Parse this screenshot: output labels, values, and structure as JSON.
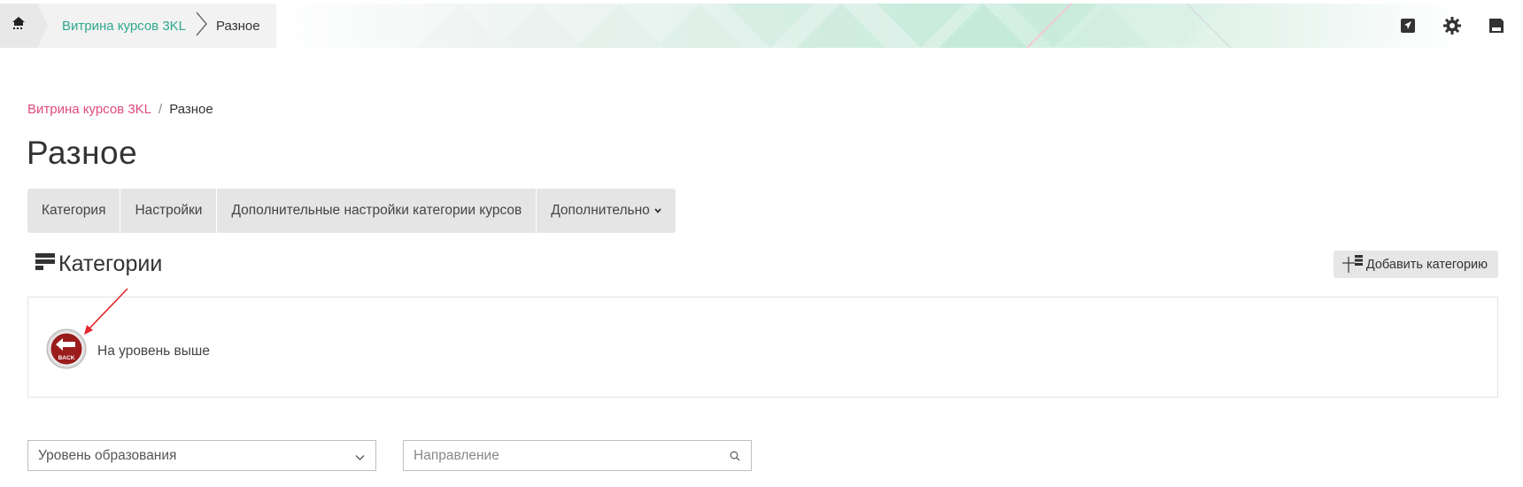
{
  "topbar": {
    "home_icon": "home-icon",
    "crumb_link": "Витрина курсов 3KL",
    "crumb_current": "Разное",
    "icons": [
      "send-icon",
      "gear-icon",
      "save-icon"
    ]
  },
  "breadcrumb": {
    "link": "Витрина курсов 3KL",
    "separator": "/",
    "current": "Разное"
  },
  "page_title": "Разное",
  "tabs": [
    {
      "label": "Категория"
    },
    {
      "label": "Настройки"
    },
    {
      "label": "Дополнительные настройки категории курсов"
    },
    {
      "label": "Дополнительно"
    }
  ],
  "categories": {
    "title": "Категории",
    "add_button": "Добавить категорию",
    "back_label": "На уровень выше",
    "back_badge": "BACK"
  },
  "filters": {
    "education_level": "Уровень образования",
    "direction_placeholder": "Направление"
  },
  "colors": {
    "accent_teal": "#2ea88f",
    "link_pink": "#e04a7f",
    "back_red": "#9b1c1c",
    "annotation_red": "#e3262b"
  }
}
